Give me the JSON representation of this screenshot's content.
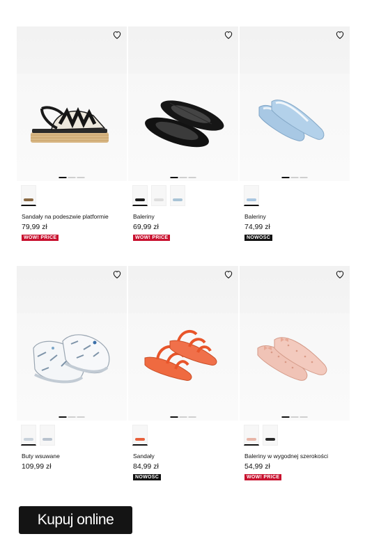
{
  "products": [
    {
      "name": "Sandały na podeszwie platformie",
      "price": "79,99 zł",
      "badge": "WOW! PRICE",
      "badge_color": "#c8102e",
      "swatch_colors": [
        "#8a6a44"
      ]
    },
    {
      "name": "Baleriny",
      "price": "69,99 zł",
      "badge": "WOW! PRICE",
      "badge_color": "#c8102e",
      "swatch_colors": [
        "#1b1b1b",
        "#dddddd",
        "#a9c4d6"
      ]
    },
    {
      "name": "Baleriny",
      "price": "74,99 zł",
      "badge": "NOWOŚĆ",
      "badge_color": "#111111",
      "swatch_colors": [
        "#a9c6e0"
      ]
    },
    {
      "name": "Buty wsuwane",
      "price": "109,99 zł",
      "badge": "",
      "badge_color": "",
      "swatch_colors": [
        "#c9d2db",
        "#b9c3cf"
      ]
    },
    {
      "name": "Sandały",
      "price": "84,99 zł",
      "badge": "NOWOŚĆ",
      "badge_color": "#111111",
      "swatch_colors": [
        "#e8613c"
      ]
    },
    {
      "name": "Baleriny w wygodnej szerokości",
      "price": "54,99 zł",
      "badge": "WOW! PRICE",
      "badge_color": "#c8102e",
      "swatch_colors": [
        "#e8b6a8",
        "#2a2a2a"
      ]
    }
  ],
  "cta": {
    "label": "Kupuj online"
  }
}
